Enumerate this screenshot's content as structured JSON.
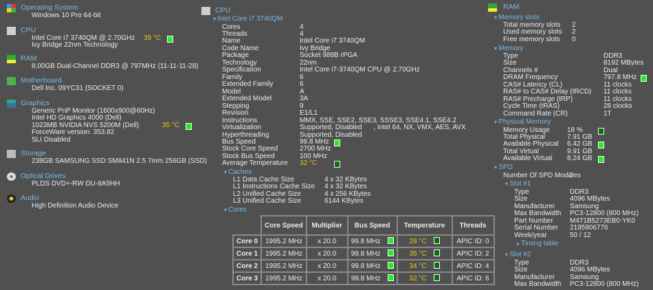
{
  "colors": {
    "background": "#505050",
    "header": "#7ab8e4",
    "temperature": "#e6c619",
    "indicator": "#22ee22"
  },
  "summary": [
    {
      "title": "Operating System",
      "icon": "windows-logo-icon",
      "lines": [
        {
          "text": "Windows 10 Pro 64-bit"
        }
      ]
    },
    {
      "title": "CPU",
      "icon": "cpu-icon",
      "lines": [
        {
          "text": "Intel Core i7 3740QM @ 2.70GHz",
          "temp": "39 °C"
        },
        {
          "text": "Ivy Bridge 22nm Technology"
        }
      ]
    },
    {
      "title": "RAM",
      "icon": "ram-icon",
      "lines": [
        {
          "text": "8,00GB Dual-Channel DDR3 @ 797MHz (11-11-11-28)"
        }
      ]
    },
    {
      "title": "Motherboard",
      "icon": "motherboard-icon",
      "lines": [
        {
          "text": "Dell Inc. 09YC31 (SOCKET 0)"
        }
      ]
    },
    {
      "title": "Graphics",
      "icon": "monitor-icon",
      "lines": [
        {
          "text": "Generic PnP Monitor (1600x900@60Hz)"
        },
        {
          "text": "Intel HD Graphics 4000 (Dell)"
        },
        {
          "text": "1023MB NVIDIA NVS 5200M (Dell)",
          "temp": "35 °C"
        },
        {
          "text": "ForceWare version: 353.82"
        },
        {
          "text": "SLI Disabled"
        }
      ]
    },
    {
      "title": "Storage",
      "icon": "storage-icon",
      "lines": [
        {
          "text": "238GB SAMSUNG SSD SM841N 2.5 7mm 256GB (SSD)"
        }
      ]
    },
    {
      "title": "Optical Drives",
      "icon": "optical-disc-icon",
      "lines": [
        {
          "text": "PLDS DVD+-RW DU-8A5HH"
        }
      ]
    },
    {
      "title": "Audio",
      "icon": "speaker-icon",
      "lines": [
        {
          "text": "High Definition Audio Device"
        }
      ]
    }
  ],
  "cpu": {
    "title": "CPU",
    "model": "Intel Core i7 3740QM",
    "props": [
      {
        "k": "Cores",
        "v": "4"
      },
      {
        "k": "Threads",
        "v": "4"
      },
      {
        "k": "Name",
        "v": "Intel Core i7 3740QM"
      },
      {
        "k": "Code Name",
        "v": "Ivy Bridge"
      },
      {
        "k": "Package",
        "v": "Socket 988B rPGA"
      },
      {
        "k": "Technology",
        "v": "22nm"
      },
      {
        "k": "Specification",
        "v": "Intel Core i7-3740QM CPU @ 2.70GHz"
      },
      {
        "k": "Family",
        "v": "6"
      },
      {
        "k": "Extended Family",
        "v": "6"
      },
      {
        "k": "Model",
        "v": "A"
      },
      {
        "k": "Extended Model",
        "v": "3A"
      },
      {
        "k": "Stepping",
        "v": "9"
      },
      {
        "k": "Revision",
        "v": "E1/L1"
      },
      {
        "k": "Instructions",
        "v": "MMX, SSE, SSE2, SSE3, SSSE3, SSE4.1, SSE4.2"
      },
      {
        "k": "Virtualization",
        "v": "Supported, Disabled      , Intel 64, NX, VMX, AES, AVX"
      },
      {
        "k": "Hyperthreading",
        "v": "Supported, Disabled"
      },
      {
        "k": "Bus Speed",
        "v": "99.8 MHz",
        "ind": "bright"
      },
      {
        "k": "Stock Core Speed",
        "v": "2700 MHz"
      },
      {
        "k": "Stock Bus Speed",
        "v": "100 MHz"
      },
      {
        "k": "Average Temperature",
        "v": "32 °C",
        "temp": true,
        "ind": "dark"
      }
    ],
    "caches": {
      "title": "Caches",
      "props": [
        {
          "k": "L1 Data Cache Size",
          "v": "4 x 32 KBytes"
        },
        {
          "k": "L1 Instructions Cache Size",
          "v": "4 x 32 KBytes"
        },
        {
          "k": "L2 Unified Cache Size",
          "v": "4 x 256 KBytes"
        },
        {
          "k": "L3 Unified Cache Size",
          "v": "6144 KBytes"
        }
      ]
    },
    "cores": {
      "title": "Cores",
      "headers": [
        "Core Speed",
        "Multiplier",
        "Bus Speed",
        "Temperature",
        "Threads"
      ],
      "rows": [
        {
          "name": "Core 0",
          "speed": "1995.2 MHz",
          "mult": "x 20.0",
          "bus": "99.8 MHz",
          "temp": "28 °C",
          "threads": "APIC ID: 0"
        },
        {
          "name": "Core 1",
          "speed": "1995.2 MHz",
          "mult": "x 20.0",
          "bus": "99.8 MHz",
          "temp": "35 °C",
          "threads": "APIC ID: 2"
        },
        {
          "name": "Core 2",
          "speed": "1995.2 MHz",
          "mult": "x 20.0",
          "bus": "99.8 MHz",
          "temp": "34 °C",
          "threads": "APIC ID: 4"
        },
        {
          "name": "Core 3",
          "speed": "1995.2 MHz",
          "mult": "x 20.0",
          "bus": "99.8 MHz",
          "temp": "32 °C",
          "threads": "APIC ID: 6"
        }
      ]
    }
  },
  "ram": {
    "title": "RAM",
    "slots": {
      "title": "Memory slots",
      "props": [
        {
          "k": "Total memory slots",
          "v": "2"
        },
        {
          "k": "Used memory slots",
          "v": "2"
        },
        {
          "k": "Free memory slots",
          "v": "0"
        }
      ]
    },
    "memory": {
      "title": "Memory",
      "props": [
        {
          "k": "Type",
          "v": "DDR3"
        },
        {
          "k": "Size",
          "v": "8192 MBytes"
        },
        {
          "k": "Channels #",
          "v": "Dual"
        },
        {
          "k": "DRAM Frequency",
          "v": "797.8 MHz",
          "ind": "bright"
        },
        {
          "k": "CAS# Latency (CL)",
          "v": "11 clocks"
        },
        {
          "k": "RAS# to CAS# Delay (tRCD)",
          "v": "11 clocks"
        },
        {
          "k": "RAS# Precharge (tRP)",
          "v": "11 clocks"
        },
        {
          "k": "Cycle Time (tRAS)",
          "v": "28 clocks"
        },
        {
          "k": "Command Rate (CR)",
          "v": "1T"
        }
      ]
    },
    "physical": {
      "title": "Physical Memory",
      "props": [
        {
          "k": "Memory Usage",
          "v": "18 %",
          "ind": "dark"
        },
        {
          "k": "Total Physical",
          "v": "7.91 GB"
        },
        {
          "k": "Available Physical",
          "v": "6.42 GB",
          "ind": "bright"
        },
        {
          "k": "Total Virtual",
          "v": "9.91 GB"
        },
        {
          "k": "Available Virtual",
          "v": "8.24 GB",
          "ind": "bright"
        }
      ]
    },
    "spd": {
      "title": "SPD",
      "props": [
        {
          "k": "Number Of SPD Modules",
          "v": "2"
        }
      ],
      "slot1": {
        "title": "Slot #1",
        "props": [
          {
            "k": "Type",
            "v": "DDR3"
          },
          {
            "k": "Size",
            "v": "4096 MBytes"
          },
          {
            "k": "Manufacturer",
            "v": "Samsung"
          },
          {
            "k": "Max Bandwidth",
            "v": "PC3-12800 (800 MHz)"
          },
          {
            "k": "Part Number",
            "v": "M471B5273EB0-YK0"
          },
          {
            "k": "Serial Number",
            "v": "2195906776"
          },
          {
            "k": "Week/year",
            "v": "50 / 12"
          }
        ],
        "timing": "Timing table"
      },
      "slot2": {
        "title": "Slot #2",
        "props": [
          {
            "k": "Type",
            "v": "DDR3"
          },
          {
            "k": "Size",
            "v": "4096 MBytes"
          },
          {
            "k": "Manufacturer",
            "v": "Samsung"
          },
          {
            "k": "Max Bandwidth",
            "v": "PC3-12800 (800 MHz)"
          }
        ]
      }
    }
  }
}
